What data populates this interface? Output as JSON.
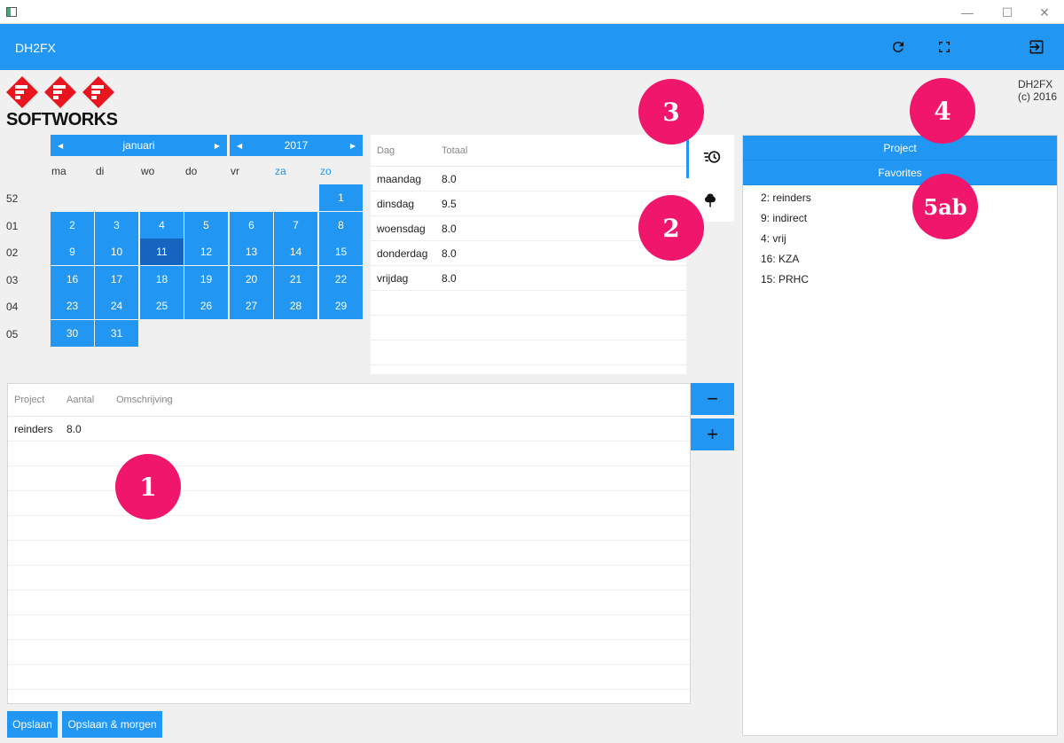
{
  "app": {
    "title": "DH2FX",
    "version_name": "DH2FX",
    "version_copyright": "(c) 2016",
    "logo_text": "SOFTWORKS"
  },
  "window_controls": {
    "minimize": "—",
    "maximize": "☐",
    "close": "✕"
  },
  "toolbar_icons": [
    "refresh-icon",
    "fullscreen-icon",
    "logout-icon"
  ],
  "calendar": {
    "month": "januari",
    "year": "2017",
    "weekdays": [
      "ma",
      "di",
      "wo",
      "do",
      "vr",
      "za",
      "zo"
    ],
    "weeks": [
      {
        "num": "52",
        "days": [
          "",
          "",
          "",
          "",
          "",
          "",
          "1"
        ]
      },
      {
        "num": "01",
        "days": [
          "2",
          "3",
          "4",
          "5",
          "6",
          "7",
          "8"
        ]
      },
      {
        "num": "02",
        "days": [
          "9",
          "10",
          "11",
          "12",
          "13",
          "14",
          "15"
        ]
      },
      {
        "num": "03",
        "days": [
          "16",
          "17",
          "18",
          "19",
          "20",
          "21",
          "22"
        ]
      },
      {
        "num": "04",
        "days": [
          "23",
          "24",
          "25",
          "26",
          "27",
          "28",
          "29"
        ]
      },
      {
        "num": "05",
        "days": [
          "30",
          "31",
          "",
          "",
          "",
          "",
          ""
        ]
      }
    ],
    "selected_day": "11"
  },
  "totals": {
    "headers": {
      "dag": "Dag",
      "totaal": "Totaal"
    },
    "rows": [
      {
        "dag": "maandag",
        "totaal": "8.0"
      },
      {
        "dag": "dinsdag",
        "totaal": "9.5"
      },
      {
        "dag": "woensdag",
        "totaal": "8.0"
      },
      {
        "dag": "donderdag",
        "totaal": "8.0"
      },
      {
        "dag": "vrijdag",
        "totaal": "8.0"
      }
    ],
    "empty_rows": 3
  },
  "entries": {
    "headers": {
      "project": "Project",
      "aantal": "Aantal",
      "omschrijving": "Omschrijving"
    },
    "rows": [
      {
        "project": "reinders",
        "aantal": "8.0",
        "omschrijving": ""
      }
    ],
    "empty_rows": 10,
    "minus_label": "−",
    "plus_label": "+"
  },
  "buttons": {
    "save": "Opslaan",
    "save_tomorrow": "Opslaan & morgen"
  },
  "right_panel": {
    "tab_project": "Project",
    "tab_favorites": "Favorites",
    "favorites": [
      "2: reinders",
      "9: indirect",
      "4: vrij",
      "16: KZA",
      "15: PRHC"
    ]
  },
  "badges": [
    "1",
    "2",
    "3",
    "4",
    "5ab"
  ],
  "colors": {
    "accent": "#2196f3",
    "selected": "#1565c0",
    "badge": "#f0166b",
    "logo": "#e8141e"
  }
}
